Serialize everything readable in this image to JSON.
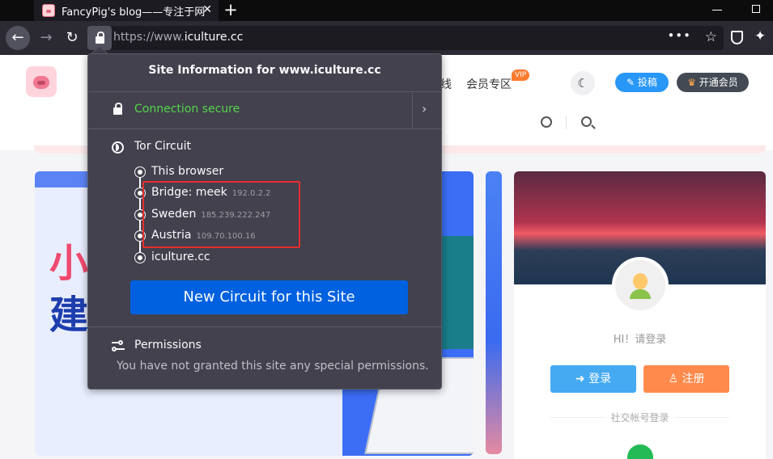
{
  "browser": {
    "tab_title": "FancyPig's blog——专注于网",
    "tab_close": "✕",
    "new_tab": "+",
    "url_prefix": "https://www.",
    "url_domain": "iculture.cc",
    "page_actions": "•••",
    "bookmark": "☆",
    "back": "←",
    "forward": "→",
    "reload": "↻"
  },
  "site": {
    "nav_partial": "线",
    "nav_vip": "会员专区",
    "vip_badge": "VIP",
    "moon": "☾",
    "submit_label": "投稿",
    "member_label": "开通会员",
    "banner_line1": "小",
    "banner_line2": "建",
    "hi_text": "HI！请登录",
    "login_label": "登录",
    "register_label": "注册",
    "social_label": "社交帐号登录"
  },
  "popup": {
    "title": "Site Information for www.iculture.cc",
    "connection_status": "Connection secure",
    "circuit_heading": "Tor Circuit",
    "nodes": [
      {
        "name": "This browser",
        "ip": ""
      },
      {
        "name": "Bridge: meek",
        "ip": "192.0.2.2"
      },
      {
        "name": "Sweden",
        "ip": "185.239.222.247"
      },
      {
        "name": "Austria",
        "ip": "109.70.100.16"
      },
      {
        "name": "iculture.cc",
        "ip": ""
      }
    ],
    "new_circuit_label": "New Circuit for this Site",
    "permissions_heading": "Permissions",
    "permissions_text": "You have not granted this site any special permissions.",
    "secure_color": "#55d64a",
    "button_color": "#0061e0",
    "highlight_color": "#e62e2e"
  }
}
